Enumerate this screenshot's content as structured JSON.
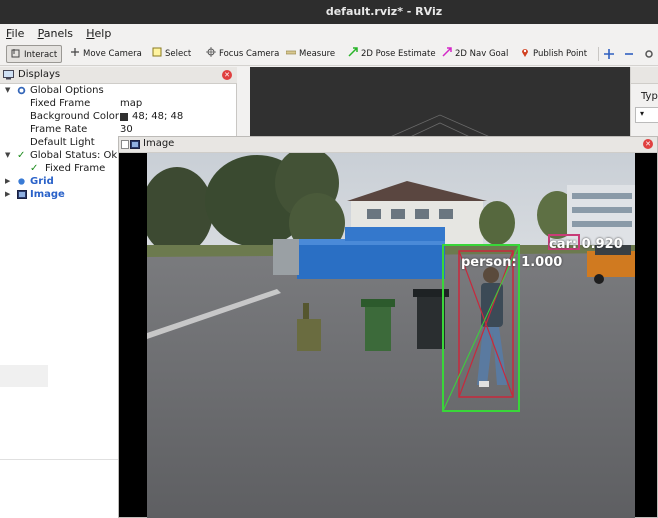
{
  "window": {
    "title": "default.rviz* - RViz"
  },
  "menu": [
    "File",
    "Panels",
    "Help"
  ],
  "toolbar": {
    "interact": "Interact",
    "move_camera": "Move Camera",
    "select": "Select",
    "focus_camera": "Focus Camera",
    "measure": "Measure",
    "pose_estimate": "2D Pose Estimate",
    "nav_goal": "2D Nav Goal",
    "publish_point": "Publish Point"
  },
  "displays": {
    "title": "Displays",
    "global_options": "Global Options",
    "fixed_frame_label": "Fixed Frame",
    "fixed_frame_value": "map",
    "background_color_label": "Background Color",
    "background_color_value": "48; 48; 48",
    "frame_rate_label": "Frame Rate",
    "frame_rate_value": "30",
    "default_light_label": "Default Light",
    "global_status": "Global Status: Ok",
    "status_fixed_frame": "Fixed Frame",
    "grid": "Grid",
    "image": "Image"
  },
  "right_panel": {
    "label": "Typ"
  },
  "image_window": {
    "title": "Image",
    "detections": [
      {
        "label": "person: 1.000",
        "color": "#2ee02e"
      },
      {
        "label": "car: 0.920",
        "color": "#c0306a"
      }
    ]
  },
  "colors": {
    "background_swatch": "#303030",
    "person_box": "#39d639",
    "person_inner": "#c8283c",
    "car_box": "#c83c78"
  }
}
